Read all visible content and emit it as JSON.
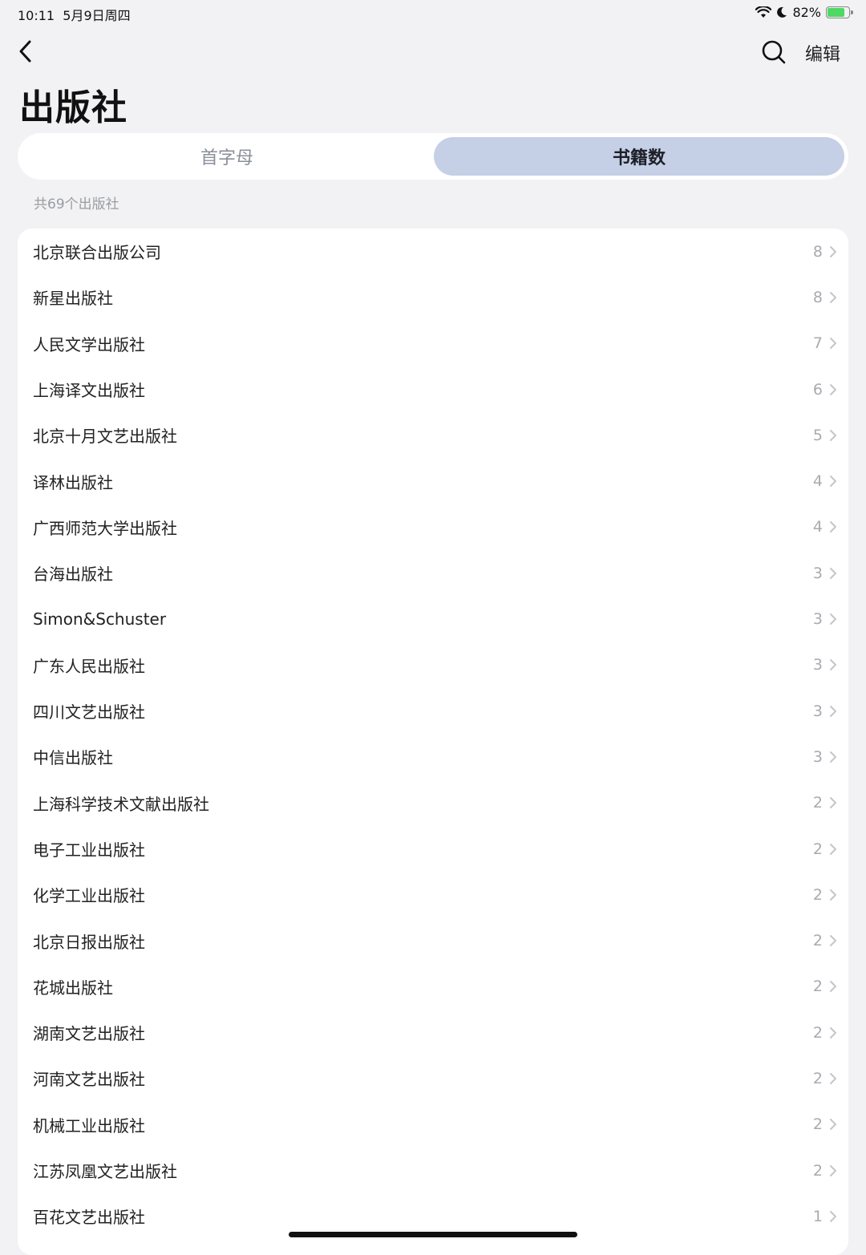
{
  "status": {
    "time": "10:11",
    "date": "5月9日周四",
    "battery": "82%",
    "battery_level": 0.82,
    "battery_color": "#4cd964"
  },
  "header": {
    "title": "出版社",
    "edit_label": "编辑",
    "back_icon": "chevron-left-icon",
    "search_icon": "search-icon"
  },
  "tabs": {
    "left_label": "首字母",
    "right_label": "书籍数",
    "active": "书籍数",
    "active_color": "#c5cfe6"
  },
  "summary": "共69个出版社",
  "publishers": [
    {
      "name": "北京联合出版公司",
      "count": "8"
    },
    {
      "name": "新星出版社",
      "count": "8"
    },
    {
      "name": "人民文学出版社",
      "count": "7"
    },
    {
      "name": "上海译文出版社",
      "count": "6"
    },
    {
      "name": "北京十月文艺出版社",
      "count": "5"
    },
    {
      "name": "译林出版社",
      "count": "4"
    },
    {
      "name": "广西师范大学出版社",
      "count": "4"
    },
    {
      "name": "台海出版社",
      "count": "3"
    },
    {
      "name": "Simon&Schuster",
      "count": "3"
    },
    {
      "name": "广东人民出版社",
      "count": "3"
    },
    {
      "name": "四川文艺出版社",
      "count": "3"
    },
    {
      "name": "中信出版社",
      "count": "3"
    },
    {
      "name": "上海科学技术文献出版社",
      "count": "2"
    },
    {
      "name": "电子工业出版社",
      "count": "2"
    },
    {
      "name": "化学工业出版社",
      "count": "2"
    },
    {
      "name": "北京日报出版社",
      "count": "2"
    },
    {
      "name": "花城出版社",
      "count": "2"
    },
    {
      "name": "湖南文艺出版社",
      "count": "2"
    },
    {
      "name": "河南文艺出版社",
      "count": "2"
    },
    {
      "name": "机械工业出版社",
      "count": "2"
    },
    {
      "name": "江苏凤凰文艺出版社",
      "count": "2"
    },
    {
      "name": "百花文艺出版社",
      "count": "1"
    }
  ]
}
